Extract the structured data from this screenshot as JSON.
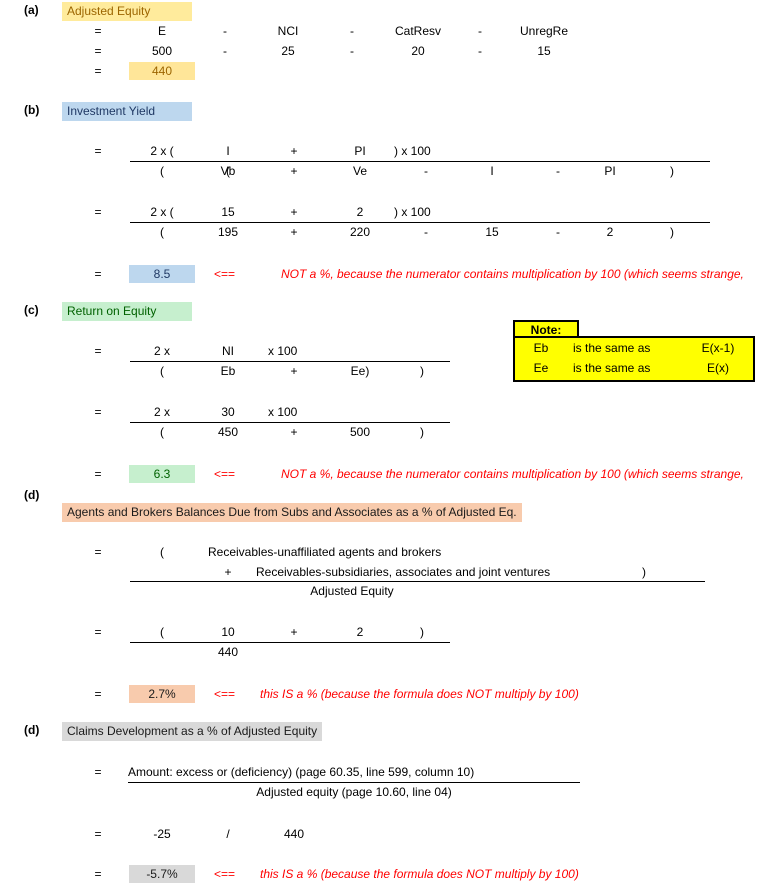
{
  "sections": {
    "a": {
      "marker": "(a)",
      "title": "Adjusted Equity",
      "eq": "=",
      "vars": [
        "E",
        "NCI",
        "CatResv",
        "UnregRe"
      ],
      "ops": [
        "-",
        "-",
        "-"
      ],
      "values": [
        "500",
        "25",
        "20",
        "15"
      ],
      "result": "440"
    },
    "b": {
      "marker": "(b)",
      "title": "Investment Yield",
      "eq": "=",
      "symbolic": {
        "num_lead": "2 x (",
        "num_a": "I",
        "num_op": "+",
        "num_b": "PI",
        "num_close": ") x 100",
        "den_lead": "(",
        "den_a": "Vb",
        "den_op1": "+",
        "den_b": "Ve",
        "den_op2": "-",
        "den_c": "I",
        "den_op3": "-",
        "den_d": "PI",
        "den_close": ")"
      },
      "numeric": {
        "num_lead": "2 x (",
        "num_a": "15",
        "num_op": "+",
        "num_b": "2",
        "num_close": ") x 100",
        "den_lead": "(",
        "den_a": "195",
        "den_op1": "+",
        "den_b": "220",
        "den_op2": "-",
        "den_c": "15",
        "den_op3": "-",
        "den_d": "2",
        "den_close": ")"
      },
      "result": "8.5",
      "arrow": "<==",
      "note": "NOT a %, because the numerator contains multiplication by 100 (which seems strange,"
    },
    "c": {
      "marker": "(c)",
      "title": "Return on Equity",
      "eq": "=",
      "symbolic": {
        "num_lead": "2 x",
        "num_a": "NI",
        "num_close": "x 100",
        "den_lead": "(",
        "den_a": "Eb",
        "den_op": "+",
        "den_b": "Ee)",
        "den_close": ")"
      },
      "numeric": {
        "num_lead": "2 x",
        "num_a": "30",
        "num_close": "x 100",
        "den_lead": "(",
        "den_a": "450",
        "den_op": "+",
        "den_b": "500",
        "den_close": ")"
      },
      "result": "6.3",
      "arrow": "<==",
      "note": "NOT a %, because the numerator contains multiplication by 100 (which seems strange,"
    },
    "d1": {
      "marker": "(d)",
      "title": "Agents and Brokers Balances Due from Subs and Associates as a % of Adjusted Eq.",
      "eq": "=",
      "symbolic": {
        "num_lead": "(",
        "num_line1": "Receivables-unaffiliated agents and brokers",
        "num_op": "+",
        "num_line2": "Receivables-subsidiaries, associates and joint ventures",
        "num_close": ")",
        "den": "Adjusted Equity"
      },
      "numeric": {
        "num_lead": "(",
        "num_a": "10",
        "num_op": "+",
        "num_b": "2",
        "num_close": ")",
        "den": "440"
      },
      "result": "2.7%",
      "arrow": "<==",
      "note": "this IS a % (because the formula does NOT multiply by 100)"
    },
    "d2": {
      "marker": "(d)",
      "title": "Claims Development as a % of Adjusted Equity",
      "eq": "=",
      "symbolic": {
        "num": "Amount: excess or (deficiency) (page 60.35, line 599, column 10)",
        "den": "Adjusted equity (page 10.60, line 04)"
      },
      "numeric": {
        "value": "-25",
        "op": "/",
        "den": "440"
      },
      "result": "-5.7%",
      "arrow": "<==",
      "note": "this IS a % (because the formula does NOT multiply by 100)"
    }
  },
  "note_box": {
    "header": "Note:",
    "rows": [
      {
        "term": "Eb",
        "phrase": "is the same as",
        "equiv": "E(x-1)"
      },
      {
        "term": "Ee",
        "phrase": "is the same as",
        "equiv": "E(x)"
      }
    ]
  },
  "colors": {
    "neutral_bg": "#FFEB9C",
    "neutral_fg": "#9C6500",
    "blue_bg": "#BDD7EE",
    "blue_fg": "#1F3864",
    "green_bg": "#C6EFCE",
    "green_fg": "#006100",
    "orange_bg": "#F8CBAD",
    "grey_bg": "#D9D9D9",
    "note_bg": "#FFFF00",
    "red": "#FF0000"
  }
}
